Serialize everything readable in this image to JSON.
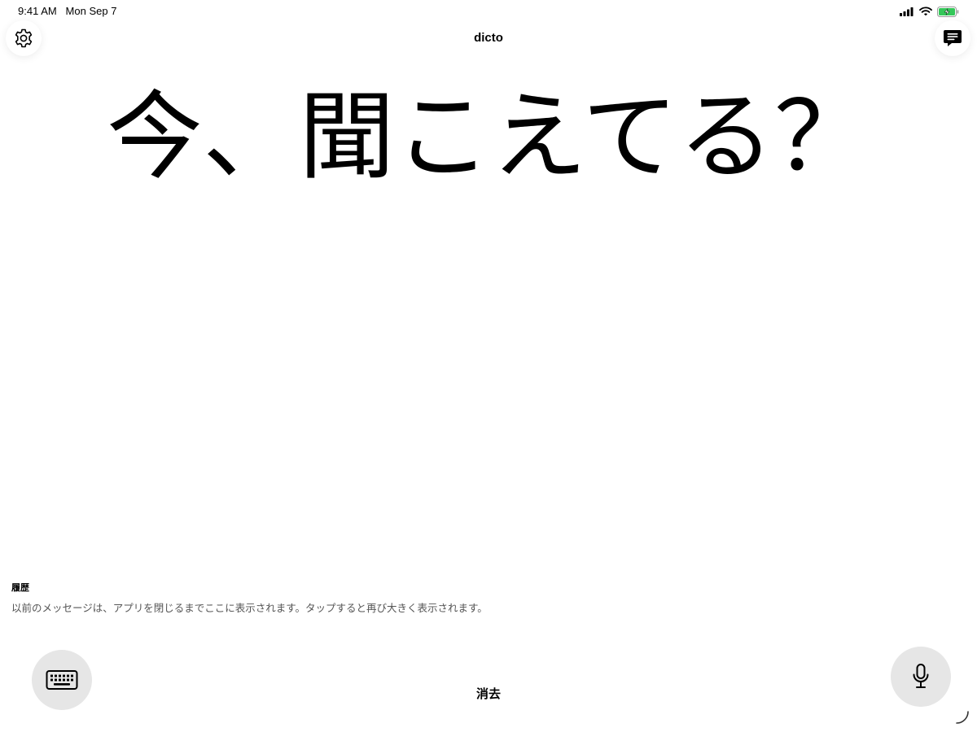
{
  "status_bar": {
    "time": "9:41 AM",
    "date": "Mon Sep 7",
    "icons": [
      "signal-icon",
      "wifi-icon",
      "battery-charging-icon"
    ],
    "battery_color": "#34c759"
  },
  "header": {
    "title": "dicto",
    "left_icon": "gear-icon",
    "right_icon": "chat-bubble-icon"
  },
  "message": {
    "text": "今、聞こえてる？"
  },
  "history": {
    "title": "履歴",
    "description": "以前のメッセージは、アプリを閉じるまでここに表示されます。タップすると再び大きく表示されます。"
  },
  "controls": {
    "keyboard_icon": "keyboard-icon",
    "clear_label": "消去",
    "mic_icon": "microphone-icon",
    "button_bg": "#e6e6e6"
  }
}
